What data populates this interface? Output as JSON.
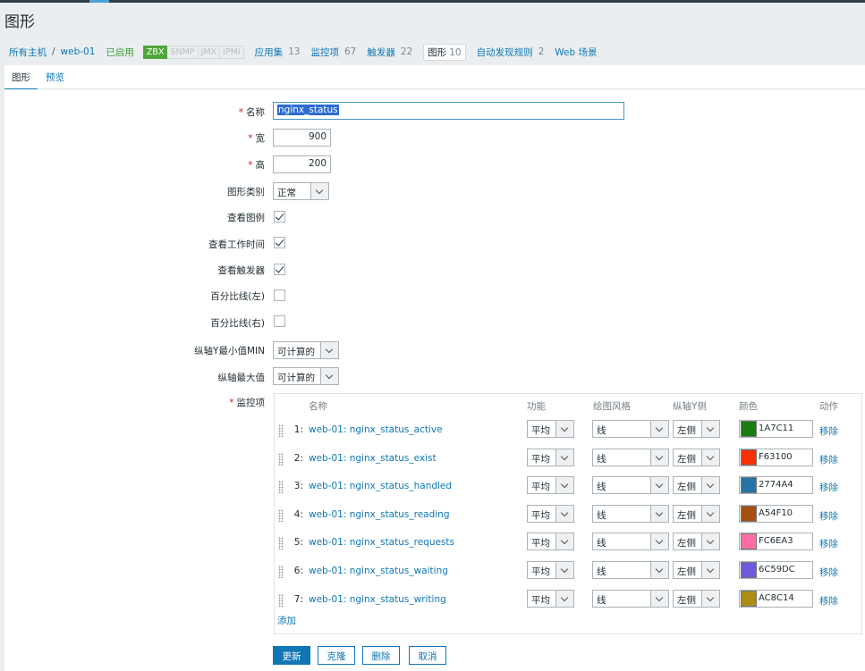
{
  "page_title": "图形",
  "breadcrumb": {
    "all_hosts": "所有主机",
    "sep": "/",
    "host": "web-01",
    "status": "已启用",
    "zbx": "ZBX",
    "snmp": "SNMP",
    "jmx": "JMX",
    "ipmi": "IPMI",
    "apps_label": "应用集",
    "apps_count": "13",
    "items_label": "监控项",
    "items_count": "67",
    "triggers_label": "触发器",
    "triggers_count": "22",
    "graphs_label": "图形",
    "graphs_count": "10",
    "discovery_label": "自动发现规则",
    "discovery_count": "2",
    "web_label": "Web 场景"
  },
  "tabs": {
    "graph": "图形",
    "preview": "预览"
  },
  "form": {
    "name_label": "名称",
    "name_value": "nginx_status",
    "width_label": "宽",
    "width_value": "900",
    "height_label": "高",
    "height_value": "200",
    "type_label": "图形类别",
    "type_value": "正常",
    "show_legend_label": "查看图例",
    "show_legend": true,
    "show_worktime_label": "查看工作时间",
    "show_worktime": true,
    "show_triggers_label": "查看触发器",
    "show_triggers": true,
    "percent_left_label": "百分比线(左)",
    "percent_left": false,
    "percent_right_label": "百分比线(右)",
    "percent_right": false,
    "ymin_label": "纵轴Y最小值MIN",
    "ymin_value": "可计算的",
    "ymax_label": "纵轴最大值",
    "ymax_value": "可计算的",
    "items_label": "监控项"
  },
  "items_table": {
    "headers": {
      "name": "名称",
      "function": "功能",
      "draw_style": "绘图风格",
      "y_axis": "纵轴Y侧",
      "color": "颜色",
      "action": "动作"
    },
    "rows": [
      {
        "num": "1:",
        "name": "web-01: nginx_status_active",
        "function": "平均",
        "style": "线",
        "axis": "左侧",
        "color": "1A7C11",
        "hex": "#1A7C11",
        "action": "移除"
      },
      {
        "num": "2:",
        "name": "web-01: nginx_status_exist",
        "function": "平均",
        "style": "线",
        "axis": "左侧",
        "color": "F63100",
        "hex": "#F63100",
        "action": "移除"
      },
      {
        "num": "3:",
        "name": "web-01: nginx_status_handled",
        "function": "平均",
        "style": "线",
        "axis": "左侧",
        "color": "2774A4",
        "hex": "#2774A4",
        "action": "移除"
      },
      {
        "num": "4:",
        "name": "web-01: nginx_status_reading",
        "function": "平均",
        "style": "线",
        "axis": "左侧",
        "color": "A54F10",
        "hex": "#A54F10",
        "action": "移除"
      },
      {
        "num": "5:",
        "name": "web-01: nginx_status_requests",
        "function": "平均",
        "style": "线",
        "axis": "左侧",
        "color": "FC6EA3",
        "hex": "#FC6EA3",
        "action": "移除"
      },
      {
        "num": "6:",
        "name": "web-01: nginx_status_waiting",
        "function": "平均",
        "style": "线",
        "axis": "左侧",
        "color": "6C59DC",
        "hex": "#6C59DC",
        "action": "移除"
      },
      {
        "num": "7:",
        "name": "web-01: nginx_status_writing",
        "function": "平均",
        "style": "线",
        "axis": "左侧",
        "color": "AC8C14",
        "hex": "#AC8C14",
        "action": "移除"
      }
    ],
    "add_label": "添加"
  },
  "buttons": {
    "update": "更新",
    "clone": "克隆",
    "delete": "删除",
    "cancel": "取消"
  },
  "colors": {
    "accent": "#0f77b3",
    "enabled": "#3aa03a",
    "required": "#d21e1e"
  }
}
